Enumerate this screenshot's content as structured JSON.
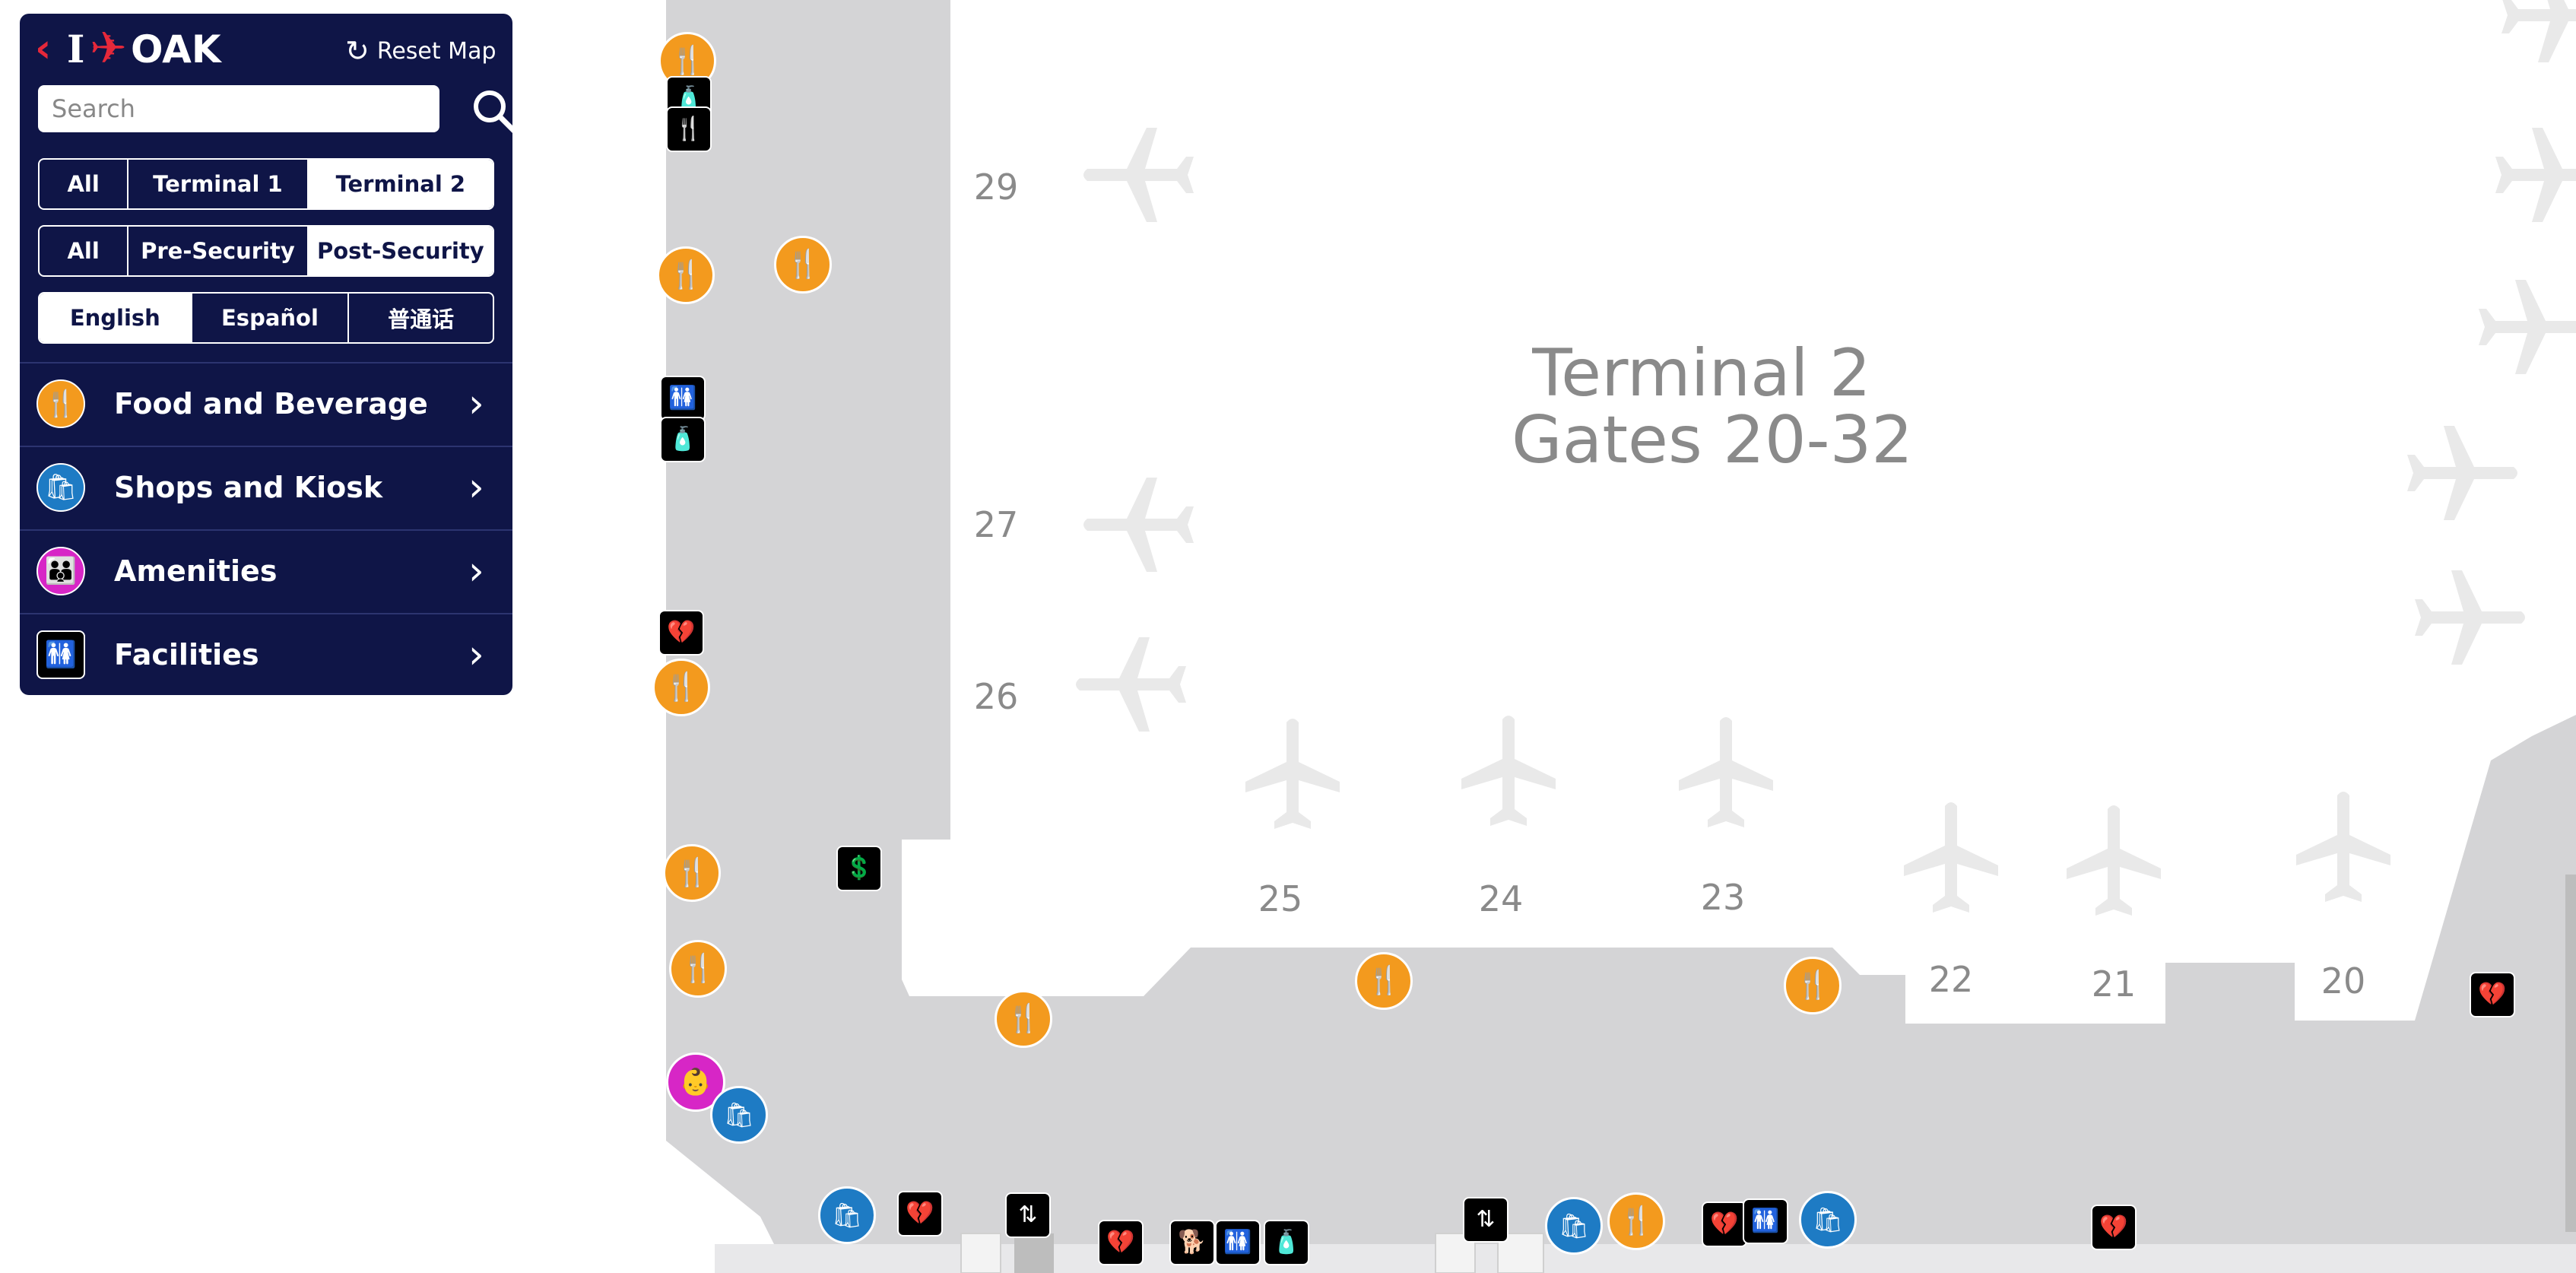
{
  "header": {
    "back_glyph": "‹",
    "logo_i": "I",
    "logo_oak": "OAK",
    "reset_label": "Reset Map"
  },
  "search": {
    "placeholder": "Search"
  },
  "terminal_filter": [
    "All",
    "Terminal 1",
    "Terminal 2"
  ],
  "terminal_selected": "Terminal 2",
  "security_filter": [
    "All",
    "Pre-Security",
    "Post-Security"
  ],
  "security_selected": "Post-Security",
  "language_filter": [
    "English",
    "Español",
    "普通话"
  ],
  "language_selected": "English",
  "categories": [
    {
      "label": "Food and Beverage",
      "icon": "fork-knife-icon",
      "color": "#f39a1e"
    },
    {
      "label": "Shops and Kiosk",
      "icon": "shopping-bag-icon",
      "color": "#1e7bc4"
    },
    {
      "label": "Amenities",
      "icon": "family-icon",
      "color": "#d726c6"
    },
    {
      "label": "Facilities",
      "icon": "restroom-icon",
      "color": "#000000"
    }
  ],
  "map": {
    "terminal_title": "Terminal 2",
    "terminal_subtitle": "Gates 20-32",
    "gates": [
      "29",
      "27",
      "26",
      "25",
      "24",
      "23",
      "22",
      "21",
      "20"
    ]
  },
  "colors": {
    "panel": "#0f1547",
    "concourse": "#d4d4d6",
    "food": "#f39a1e",
    "shop": "#1e7bc4",
    "amenity": "#d726c6",
    "brand_red": "#e5283a"
  }
}
